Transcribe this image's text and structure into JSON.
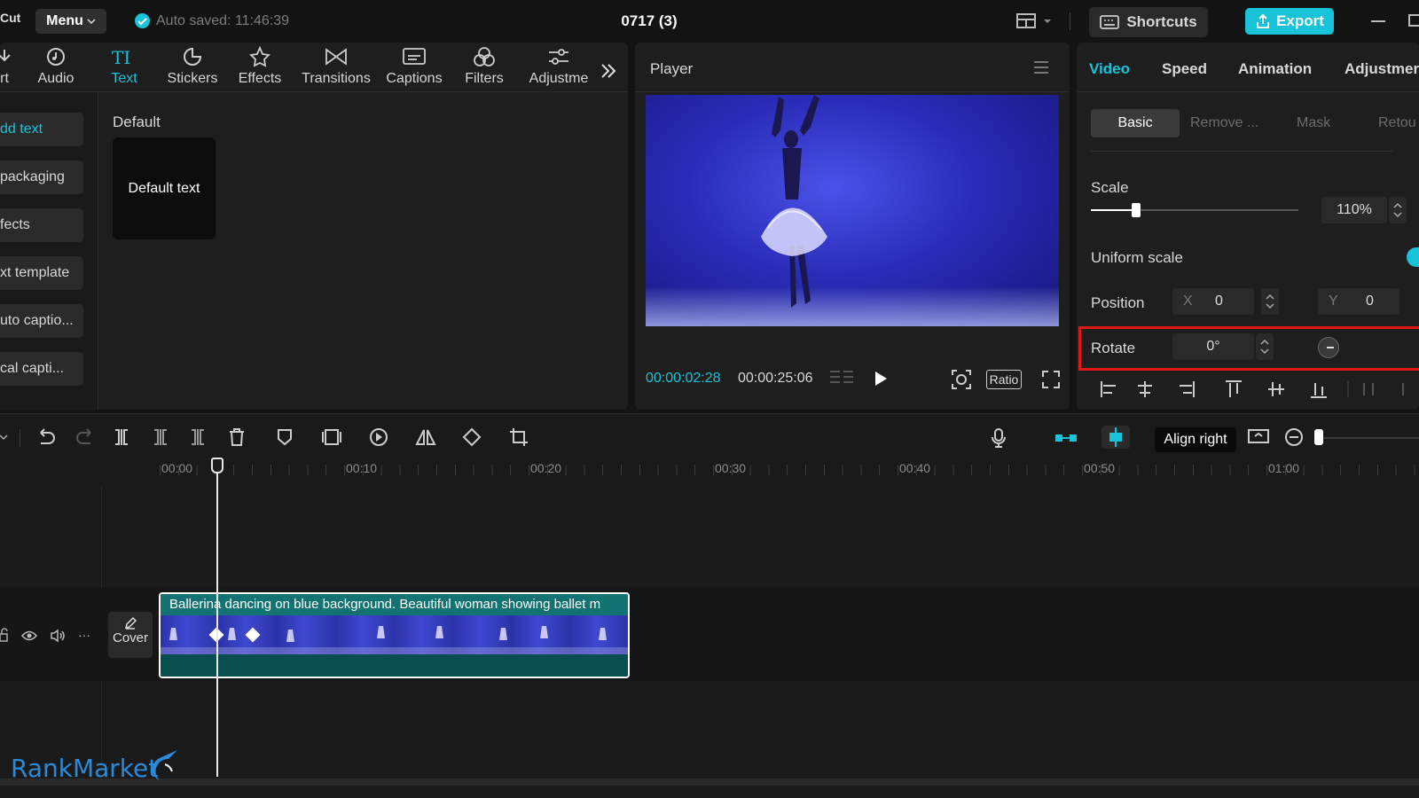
{
  "topbar": {
    "app_fragment": "Cut",
    "menu_label": "Menu",
    "autosave_text": "Auto saved: 11:46:39",
    "project_title": "0717 (3)",
    "shortcuts_label": "Shortcuts",
    "export_label": "Export"
  },
  "toolbar": {
    "items": [
      {
        "label": "rt",
        "icon": "import-icon"
      },
      {
        "label": "Audio",
        "icon": "audio-icon"
      },
      {
        "label": "Text",
        "icon": "text-icon"
      },
      {
        "label": "Stickers",
        "icon": "stickers-icon"
      },
      {
        "label": "Effects",
        "icon": "effects-icon"
      },
      {
        "label": "Transitions",
        "icon": "transitions-icon"
      },
      {
        "label": "Captions",
        "icon": "captions-icon"
      },
      {
        "label": "Filters",
        "icon": "filters-icon"
      },
      {
        "label": "Adjustme",
        "icon": "adjust-icon"
      }
    ],
    "active": "Text"
  },
  "text_sidebar": {
    "items": [
      "dd text",
      " packaging",
      "fects",
      "xt template",
      "uto captio...",
      "cal capti..."
    ]
  },
  "text_content": {
    "section_title": "Default",
    "card_label": "Default text"
  },
  "player": {
    "title": "Player",
    "current_time": "00:00:02:28",
    "total_time": "00:00:25:06",
    "ratio_label": "Ratio"
  },
  "inspector": {
    "tabs": [
      "Video",
      "Speed",
      "Animation",
      "Adjustmer"
    ],
    "active_tab": "Video",
    "subtabs": [
      "Basic",
      "Remove ...",
      "Mask",
      "Retou"
    ],
    "active_subtab": "Basic",
    "scale_label": "Scale",
    "scale_value": "110%",
    "scale_fraction": 0.22,
    "uniform_scale_label": "Uniform scale",
    "position_label": "Position",
    "pos_x_label": "X",
    "pos_x_value": "0",
    "pos_y_label": "Y",
    "pos_y_value": "0",
    "rotate_label": "Rotate",
    "rotate_value": "0°"
  },
  "timeline": {
    "tooltip": "Align right",
    "ruler": [
      "00:00",
      "00:10",
      "00:20",
      "00:30",
      "00:40",
      "00:50",
      "01:00"
    ],
    "clip_title": "Ballerina dancing on blue background. Beautiful woman showing ballet m",
    "cover_label": "Cover"
  },
  "watermark": {
    "text": "RankMarket"
  },
  "colors": {
    "accent": "#18c2d8",
    "highlight_box": "#e01818",
    "video_bg": "#2a2cb8"
  }
}
